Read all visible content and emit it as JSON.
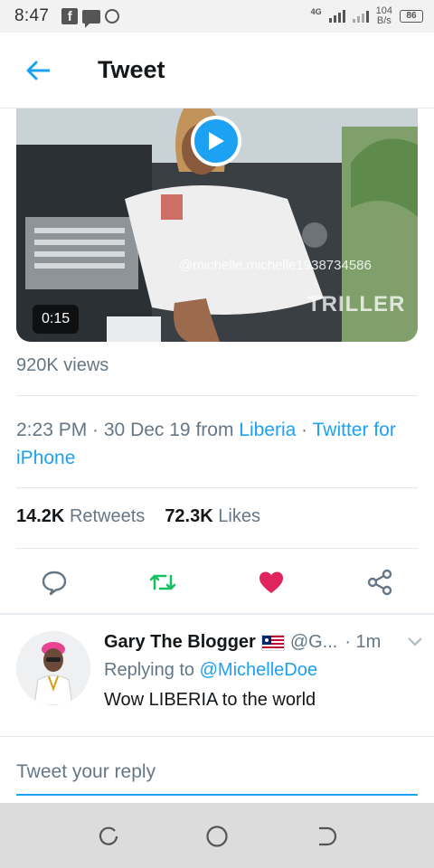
{
  "status_bar": {
    "time": "8:47",
    "network": "4G",
    "speed_value": "104",
    "speed_unit": "B/s",
    "battery": "86",
    "notification_icons": [
      "facebook-icon",
      "message-icon",
      "circle-icon"
    ]
  },
  "header": {
    "back_icon": "arrow-left-icon",
    "title": "Tweet"
  },
  "video": {
    "duration": "0:15",
    "watermark": "@michelle.michelle1938734586",
    "triller_logo": "TRILLER",
    "play_icon": "play-icon"
  },
  "stats": {
    "views": "920K views",
    "time": "2:23 PM",
    "date_sep": " · 30 Dec 19 from ",
    "location": "Liberia",
    "via_sep": " · ",
    "source": "Twitter for iPhone",
    "retweets_count": "14.2K",
    "retweets_label": "Retweets",
    "likes_count": "72.3K",
    "likes_label": "Likes"
  },
  "actions": {
    "icons": [
      "comment-icon",
      "retweet-icon",
      "like-icon",
      "share-icon"
    ],
    "retweet_color": "#17bf63",
    "like_color": "#e0245e"
  },
  "reply": {
    "name": "Gary The Blogger",
    "flag_icon": "liberia-flag-icon",
    "handle": "@G...",
    "time": "· 1m",
    "replying_prefix": "Replying to ",
    "replying_to": "@MichelleDoe",
    "text": "Wow LIBERIA to the world"
  },
  "compose": {
    "placeholder": "Tweet your reply"
  },
  "colors": {
    "accent": "#1da1f2",
    "secondary_text": "#657786"
  }
}
